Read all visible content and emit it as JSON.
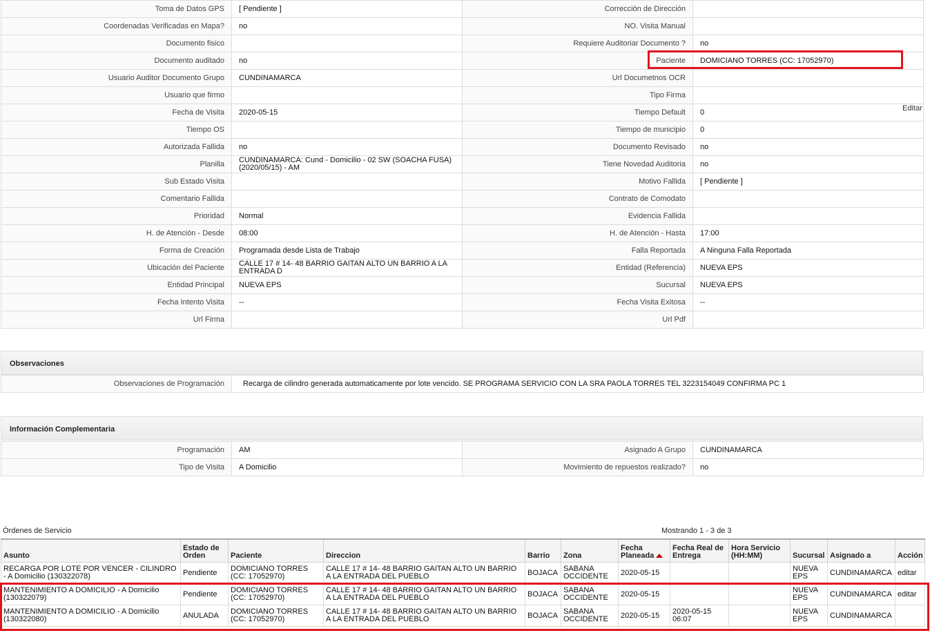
{
  "details": {
    "rows": [
      {
        "l1": "Toma de Datos GPS",
        "v1": "[ Pendiente ]",
        "l2": "Corrección de Dirección",
        "v2": ""
      },
      {
        "l1": "Coordenadas Verificadas en Mapa?",
        "v1": "no",
        "l2": "NO. Visita Manual",
        "v2": ""
      },
      {
        "l1": "Documento fisico",
        "v1": "",
        "l2": "Requiere Auditoriar Documento ?",
        "v2": "no"
      },
      {
        "l1": "Documento auditado",
        "v1": "no",
        "l2": "Paciente",
        "v2": "DOMICIANO TORRES (CC: 17052970)"
      },
      {
        "l1": "Usuario Auditor Documento Grupo",
        "v1": "CUNDINAMARCA",
        "l2": "Url Documetnos OCR",
        "v2": ""
      },
      {
        "l1": "Usuario que firmo",
        "v1": "",
        "l2": "Tipo Firma",
        "v2": ""
      },
      {
        "l1": "Fecha de Visita",
        "v1": "2020-05-15",
        "l2": "Tiempo Default",
        "v2": "0"
      },
      {
        "l1": "Tiempo OS",
        "v1": "",
        "l2": "Tiempo de municipio",
        "v2": "0"
      },
      {
        "l1": "Autorizada Fallida",
        "v1": "no",
        "l2": "Documento Revisado",
        "v2": "no"
      },
      {
        "l1": "Planilla",
        "v1": "CUNDINAMARCA: Cund - Domicilio - 02 SW (SOACHA FUSA) (2020/05/15) - AM",
        "l2": "Tiene Novedad Auditoria",
        "v2": "no"
      },
      {
        "l1": "Sub Estado Visita",
        "v1": "",
        "l2": "Motivo Fallida",
        "v2": "[ Pendiente ]"
      },
      {
        "l1": "Comentario Fallida",
        "v1": "",
        "l2": "Contrato de Comodato",
        "v2": ""
      },
      {
        "l1": "Prioridad",
        "v1": "Normal",
        "l2": "Evidencia Fallida",
        "v2": ""
      },
      {
        "l1": "H. de Atención - Desde",
        "v1": "08:00",
        "l2": "H. de Atención - Hasta",
        "v2": "17:00"
      },
      {
        "l1": "Forma de Creación",
        "v1": "Programada desde Lista de Trabajo",
        "l2": "Falla Reportada",
        "v2": "A Ninguna Falla Reportada"
      },
      {
        "l1": "Ubicación del Paciente",
        "v1": "CALLE 17 # 14- 48 BARRIO GAITAN ALTO UN BARRIO A LA ENTRADA D",
        "l2": "Entidad (Referencia)",
        "v2": "NUEVA EPS"
      },
      {
        "l1": "Entidad Principal",
        "v1": "NUEVA EPS",
        "l2": "Sucursal",
        "v2": "NUEVA EPS"
      },
      {
        "l1": "Fecha Intento Visita",
        "v1": "--",
        "l2": "Fecha Visita Exitosa",
        "v2": "--"
      },
      {
        "l1": "Url Firma",
        "v1": "",
        "l2": "Url Pdf",
        "v2": ""
      }
    ],
    "edit_label": "Editar"
  },
  "observaciones": {
    "title": "Observaciones",
    "label": "Observaciones de Programación",
    "value": "Recarga de cilindro generada automaticamente por lote vencido. SE PROGRAMA SERVICIO CON LA SRA PAOLA TORRES TEL 3223154049 CONFIRMA PC 1"
  },
  "complementaria": {
    "title": "Información Complementaria",
    "rows": [
      {
        "l1": "Programación",
        "v1": "AM",
        "l2": "Asignado A Grupo",
        "v2": "CUNDINAMARCA"
      },
      {
        "l1": "Tipo de Visita",
        "v1": "A Domicilio",
        "l2": "Movimiento de repuestos realizado?",
        "v2": "no"
      }
    ]
  },
  "orders": {
    "title": "Órdenes de Servicio",
    "count_text": "Mostrando 1 - 3 de 3",
    "columns": [
      "Asunto",
      "Estado de Orden",
      "Paciente",
      "Direccion",
      "Barrio",
      "Zona",
      "Fecha Planeada",
      "Fecha Real de Entrega",
      "Hora Servicio (HH:MM)",
      "Sucursal",
      "Asignado a",
      "Acción"
    ],
    "sorted_column": "Fecha Planeada",
    "rows": [
      [
        "RECARGA POR LOTE POR VENCER - CILINDRO - A Domicilio (130322078)",
        "Pendiente",
        "DOMICIANO TORRES (CC: 17052970)",
        "CALLE 17 # 14- 48 BARRIO GAITAN ALTO UN BARRIO A LA ENTRADA DEL PUEBLO",
        "BOJACA",
        "SABANA OCCIDENTE",
        "2020-05-15",
        "",
        "",
        "NUEVA EPS",
        "CUNDINAMARCA",
        "editar"
      ],
      [
        "MANTENIMIENTO A DOMICILIO - A Domicilio (130322079)",
        "Pendiente",
        "DOMICIANO TORRES (CC: 17052970)",
        "CALLE 17 # 14- 48 BARRIO GAITAN ALTO UN BARRIO A LA ENTRADA DEL PUEBLO",
        "BOJACA",
        "SABANA OCCIDENTE",
        "2020-05-15",
        "",
        "",
        "NUEVA EPS",
        "CUNDINAMARCA",
        "editar"
      ],
      [
        "MANTENIMIENTO A DOMICILIO - A Domicilio (130322080)",
        "ANULADA",
        "DOMICIANO TORRES (CC: 17052970)",
        "CALLE 17 # 14- 48 BARRIO GAITAN ALTO UN BARRIO A LA ENTRADA DEL PUEBLO",
        "BOJACA",
        "SABANA OCCIDENTE",
        "2020-05-15",
        "2020-05-15 06:07",
        "",
        "NUEVA EPS",
        "CUNDINAMARCA",
        ""
      ]
    ]
  },
  "highlight_color": "#e0141e",
  "sort_icon": "sort-ascending-icon"
}
